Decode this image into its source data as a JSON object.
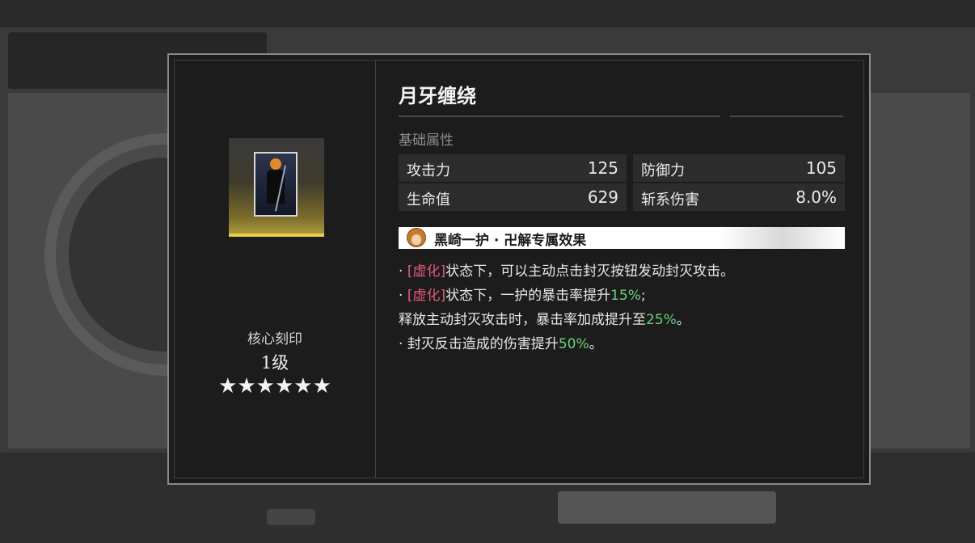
{
  "item": {
    "title": "月牙缠绕",
    "core_label": "核心刻印",
    "level": "1级",
    "stars": "★★★★★★"
  },
  "stats": {
    "section_label": "基础属性",
    "rows": [
      {
        "name": "攻击力",
        "value": "125"
      },
      {
        "name": "防御力",
        "value": "105"
      },
      {
        "name": "生命值",
        "value": "629"
      },
      {
        "name": "斩系伤害",
        "value": "8.0%"
      }
    ]
  },
  "effect": {
    "title": "黑崎一护 · 卍解专属效果",
    "lines": [
      {
        "bullet": "·",
        "kw": "[虚化]",
        "text1": "状态下，可以主动点击封灭按钮发动封灭攻击。"
      },
      {
        "bullet": "·",
        "kw": "[虚化]",
        "text1": "状态下，一护的暴击率提升",
        "num": "15%",
        "text2": ";"
      },
      {
        "text1": "释放主动封灭攻击时，暴击率加成提升至",
        "num": "25%",
        "text2": "。"
      },
      {
        "bullet": "·",
        "text1": "封灭反击造成的伤害提升",
        "num": "50%",
        "text2": "。"
      }
    ]
  },
  "colors": {
    "keyword": "#e05a7a",
    "number": "#6fcf7a",
    "accent_bar": "#e7cf45"
  },
  "icons": {
    "portrait": "character-card-icon",
    "avatar": "character-avatar-icon"
  }
}
